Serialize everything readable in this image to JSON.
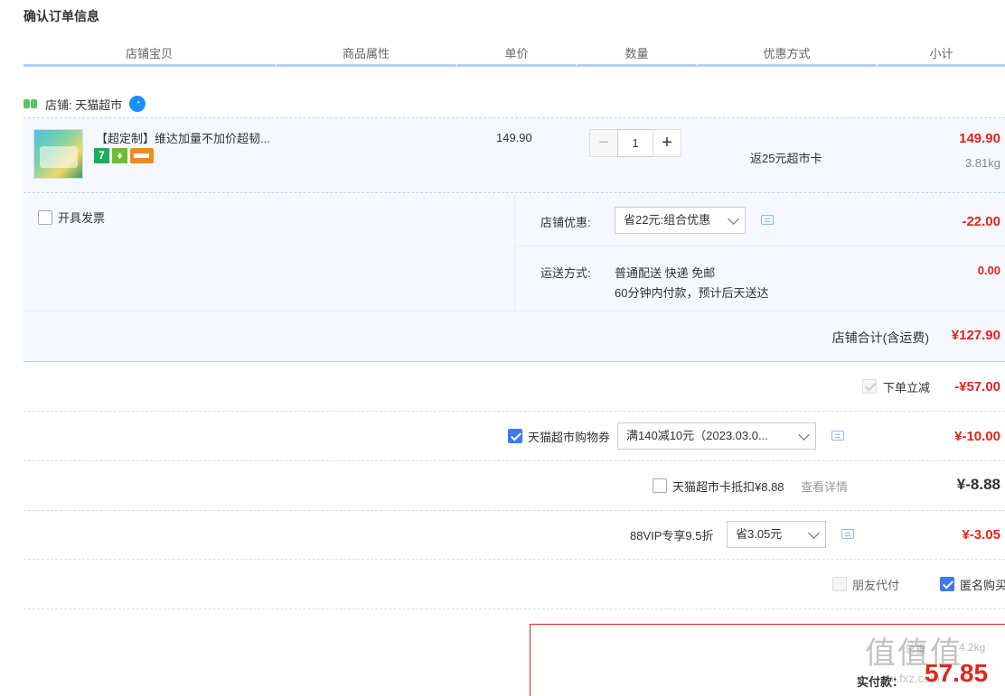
{
  "page": {
    "title": "确认订单信息"
  },
  "columns": [
    "店铺宝贝",
    "商品属性",
    "单价",
    "数量",
    "优惠方式",
    "小计"
  ],
  "shop": {
    "label": "店铺: 天猫超市"
  },
  "item": {
    "title": "【超定制】维达加量不加价超韧...",
    "unit_price": "149.90",
    "quantity": "1",
    "minus": "−",
    "plus": "+",
    "discount_method": "返25元超市卡",
    "subtotal": "149.90",
    "weight": "3.81kg",
    "badge_seven": "7"
  },
  "invoice": {
    "label": "开具发票"
  },
  "shop_discount": {
    "label": "店铺优惠:",
    "selected": "省22元:组合优惠",
    "amount": "-22.00"
  },
  "shipping": {
    "label": "运送方式:",
    "method": "普通配送 快递 免邮",
    "note": "60分钟内付款，预计后天送达",
    "amount": "0.00"
  },
  "shop_total": {
    "label": "店铺合计(含运费)",
    "amount": "¥127.90"
  },
  "instant_discount": {
    "label": "下单立减",
    "amount": "-¥57.00"
  },
  "coupon": {
    "label": "天猫超市购物券",
    "selected": "满140减10元（2023.03.0...",
    "amount": "¥-10.00"
  },
  "supermarket_card": {
    "label": "天猫超市卡抵扣¥8.88",
    "link": "查看详情",
    "amount": "¥-8.88"
  },
  "vip": {
    "label": "88VIP专享9.5折",
    "selected": "省3.05元",
    "amount": "¥-3.05"
  },
  "friend_pay": {
    "label": "朋友代付"
  },
  "anonymous": {
    "label": "匿名购买"
  },
  "payment": {
    "label": "实付款：",
    "amount": "57.85",
    "weight_label": "总重",
    "weight_value": "4.2kg"
  },
  "watermark": {
    "text": "值值值",
    "url": "zhi.fxz.com"
  },
  "colors": {
    "accent": "#3e79f0",
    "price_red": "#e1251b",
    "header_border": "#b2d1ff",
    "panel_bg": "#f5f8ff"
  }
}
